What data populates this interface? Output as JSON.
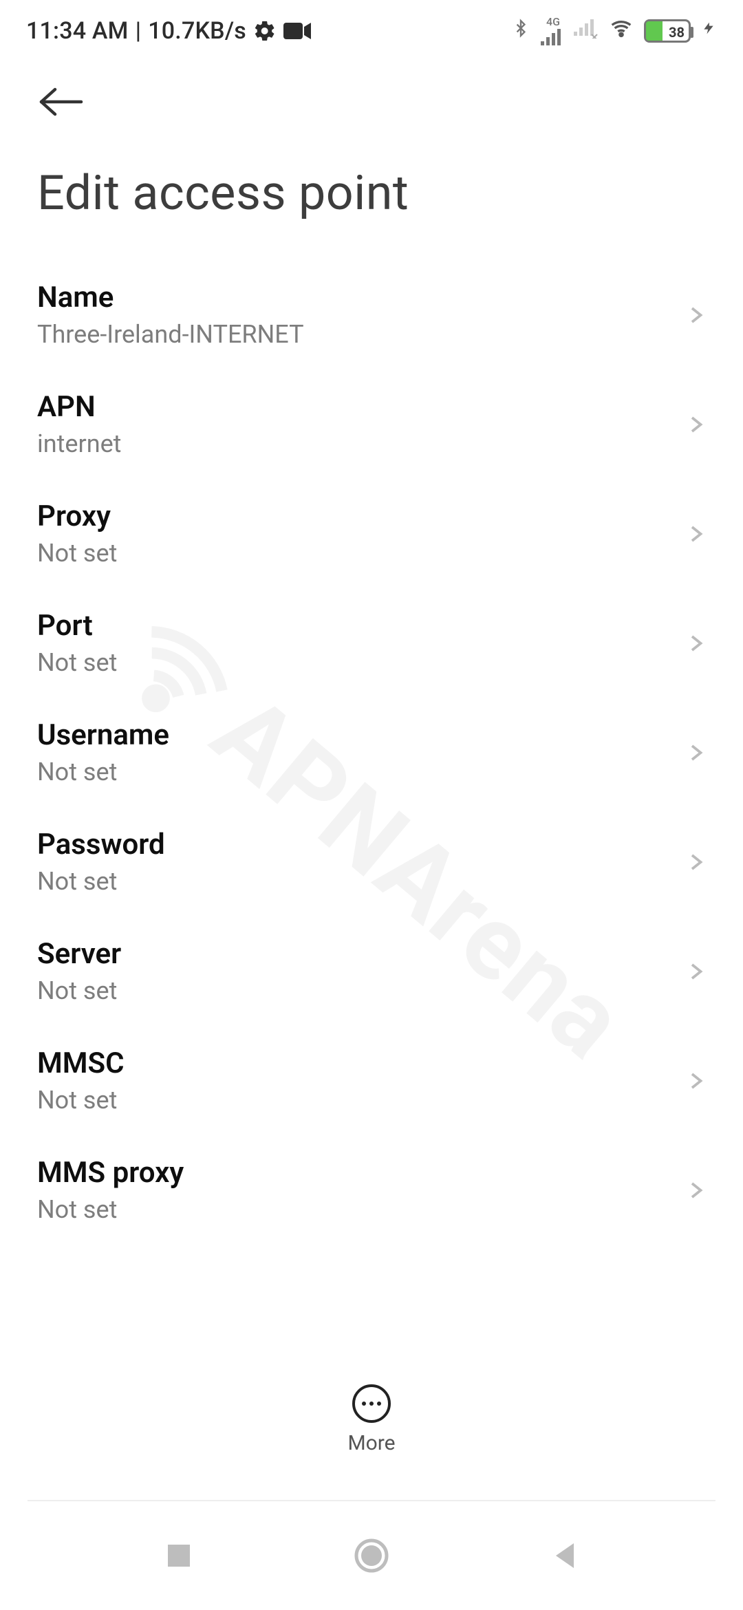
{
  "status": {
    "time": "11:34 AM",
    "separator": "|",
    "speed": "10.7KB/s",
    "network_label": "4G",
    "battery_pct": "38"
  },
  "header": {
    "title": "Edit access point"
  },
  "settings": [
    {
      "label": "Name",
      "value": "Three-Ireland-INTERNET"
    },
    {
      "label": "APN",
      "value": "internet"
    },
    {
      "label": "Proxy",
      "value": "Not set"
    },
    {
      "label": "Port",
      "value": "Not set"
    },
    {
      "label": "Username",
      "value": "Not set"
    },
    {
      "label": "Password",
      "value": "Not set"
    },
    {
      "label": "Server",
      "value": "Not set"
    },
    {
      "label": "MMSC",
      "value": "Not set"
    },
    {
      "label": "MMS proxy",
      "value": "Not set"
    }
  ],
  "float_action": {
    "label": "More"
  },
  "watermark": "APNArena"
}
